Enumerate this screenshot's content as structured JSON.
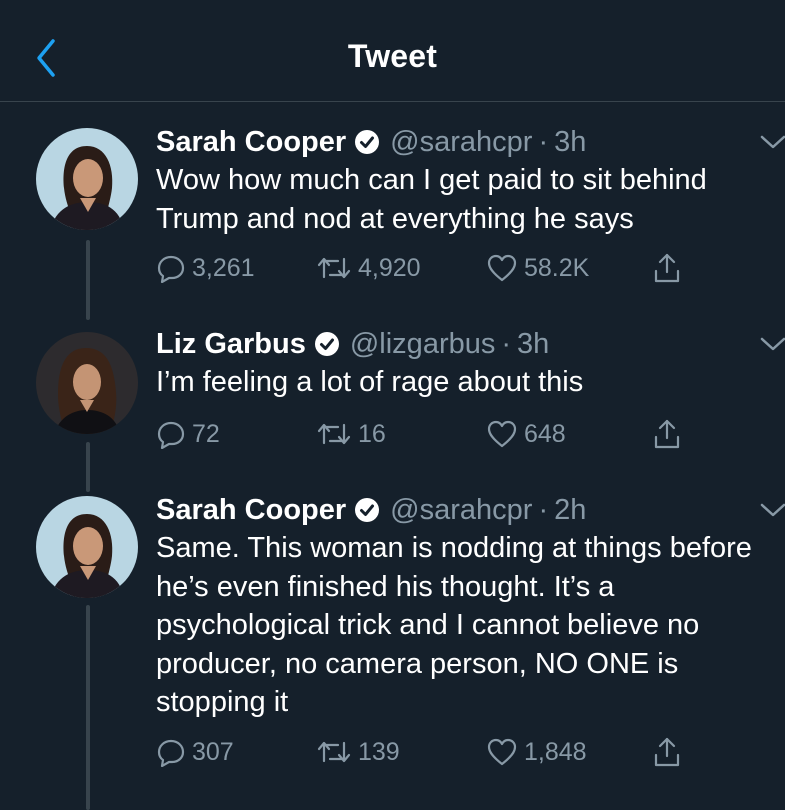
{
  "header": {
    "title": "Tweet",
    "back_icon": "chevron-left-icon"
  },
  "colors": {
    "background": "#15202b",
    "accent": "#1da1f2",
    "muted": "#8899a6",
    "divider": "#38444d"
  },
  "tweets": [
    {
      "name": "Sarah Cooper",
      "handle": "@sarahcpr",
      "separator": "·",
      "time": "3h",
      "text": "Wow how much can I get paid to sit behind Trump and nod at everything he says",
      "replies": "3,261",
      "retweets": "4,920",
      "likes": "58.2K"
    },
    {
      "name": "Liz Garbus",
      "handle": "@lizgarbus",
      "separator": "·",
      "time": "3h",
      "text": "I’m feeling a lot of rage about this",
      "replies": "72",
      "retweets": "16",
      "likes": "648"
    },
    {
      "name": "Sarah Cooper",
      "handle": "@sarahcpr",
      "separator": "·",
      "time": "2h",
      "text": "Same. This woman is nodding at things before he’s even finished his thought. It’s a psychological trick and I cannot believe no producer, no camera person, NO ONE is stopping it",
      "replies": "307",
      "retweets": "139",
      "likes": "1,848"
    }
  ]
}
